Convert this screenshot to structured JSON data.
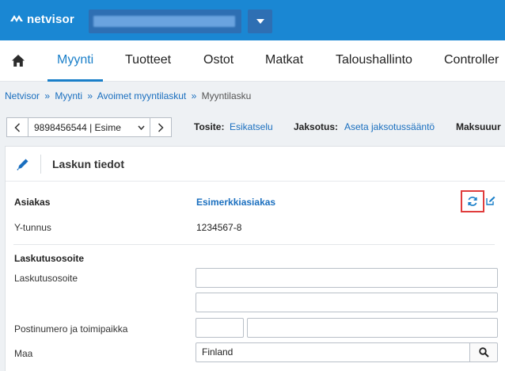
{
  "app": {
    "logo_text": "netvisor",
    "brand_color": "#1a87d3"
  },
  "nav": {
    "home_icon": "home-icon",
    "items": [
      {
        "label": "Myynti",
        "active": true
      },
      {
        "label": "Tuotteet",
        "active": false
      },
      {
        "label": "Ostot",
        "active": false
      },
      {
        "label": "Matkat",
        "active": false
      },
      {
        "label": "Taloushallinto",
        "active": false
      },
      {
        "label": "Controller",
        "active": false
      }
    ]
  },
  "breadcrumb": {
    "items": [
      "Netvisor",
      "Myynti",
      "Avoimet myyntilaskut"
    ],
    "separator": "»",
    "current": "Myyntilasku"
  },
  "toolbar": {
    "invoice_select_value": "9898456544 | Esime",
    "tosite_label": "Tosite:",
    "tosite_link": "Esikatselu",
    "jaksotus_label": "Jaksotus:",
    "jaksotus_link": "Aseta jaksotussääntö",
    "maksu_label": "Maksuuur"
  },
  "card": {
    "title": "Laskun tiedot",
    "asiakas_label": "Asiakas",
    "asiakas_value": "Esimerkkiasiakas",
    "ytunnus_label": "Y-tunnus",
    "ytunnus_value": "1234567-8",
    "section_title": "Laskutusosoite",
    "address_label": "Laskutusosoite",
    "address_line1": "",
    "address_line2": "",
    "postal_label": "Postinumero ja toimipaikka",
    "postal_code": "",
    "city": "",
    "country_label": "Maa",
    "country_value": "Finland",
    "highlight_color": "#e03c3c"
  }
}
